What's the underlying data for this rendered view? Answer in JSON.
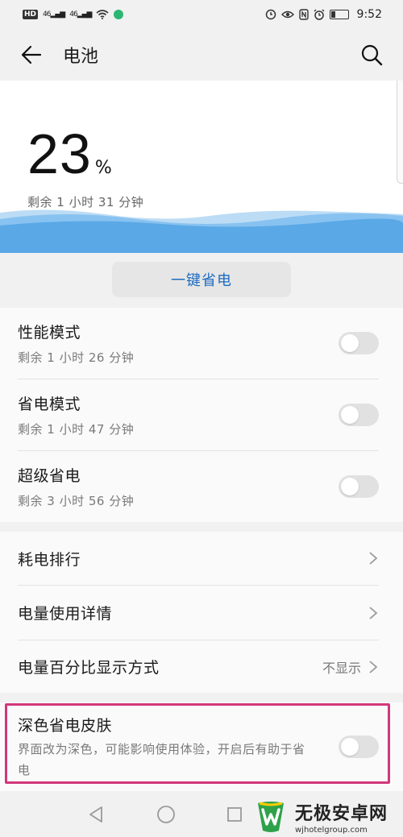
{
  "status_bar": {
    "hd_label": "HD",
    "signal_1": "46",
    "signal_2": "46",
    "time": "9:52",
    "battery_level": 0.23
  },
  "header": {
    "title": "电池",
    "back_icon": "arrow-left-icon",
    "search_icon": "search-icon"
  },
  "battery": {
    "percent": "23",
    "percent_sign": "%",
    "remaining": "剩余 1 小时 31 分钟",
    "wave_color": "#5aa8e6"
  },
  "one_click_button": "一键省电",
  "modes": [
    {
      "title": "性能模式",
      "subtitle": "剩余 1 小时 26 分钟",
      "enabled": false
    },
    {
      "title": "省电模式",
      "subtitle": "剩余 1 小时 47 分钟",
      "enabled": false
    },
    {
      "title": "超级省电",
      "subtitle": "剩余 3 小时 56 分钟",
      "enabled": false
    }
  ],
  "info_items": [
    {
      "title": "耗电排行",
      "value": ""
    },
    {
      "title": "电量使用详情",
      "value": ""
    },
    {
      "title": "电量百分比显示方式",
      "value": "不显示"
    }
  ],
  "dark_skin": {
    "title": "深色省电皮肤",
    "subtitle": "界面改为深色，可能影响使用体验，开启后有助于省电",
    "enabled": false,
    "highlight_color": "#d1377a"
  },
  "nav": [
    "back-triangle-icon",
    "home-circle-icon",
    "recents-square-icon"
  ],
  "watermark": {
    "title": "无极安卓网",
    "url": "wjhotelgroup.com"
  }
}
